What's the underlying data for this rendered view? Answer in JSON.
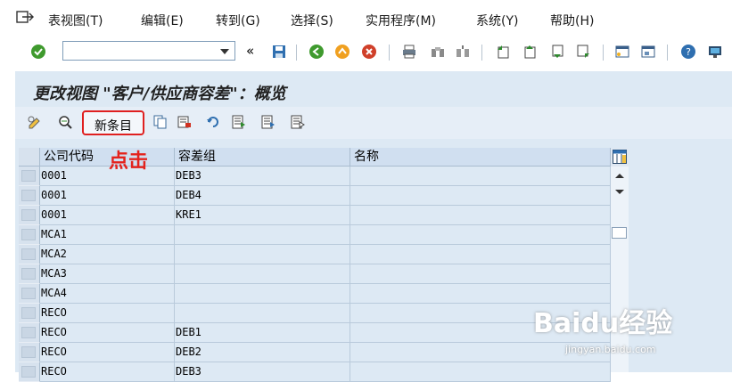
{
  "menu": [
    "表视图(T)",
    "编辑(E)",
    "转到(G)",
    "选择(S)",
    "实用程序(M)",
    "系统(Y)",
    "帮助(H)"
  ],
  "command_field": {
    "value": ""
  },
  "screen_title": "更改视图 \"客户/供应商容差\"：概览",
  "new_entries_label": "新条目",
  "annotation": "点击",
  "columns": [
    "公司代码",
    "容差组",
    "名称"
  ],
  "rows": [
    {
      "company": "0001",
      "group": "DEB3",
      "name": ""
    },
    {
      "company": "0001",
      "group": "DEB4",
      "name": ""
    },
    {
      "company": "0001",
      "group": "KRE1",
      "name": ""
    },
    {
      "company": "MCA1",
      "group": "",
      "name": ""
    },
    {
      "company": "MCA2",
      "group": "",
      "name": ""
    },
    {
      "company": "MCA3",
      "group": "",
      "name": ""
    },
    {
      "company": "MCA4",
      "group": "",
      "name": ""
    },
    {
      "company": "RECO",
      "group": "",
      "name": ""
    },
    {
      "company": "RECO",
      "group": "DEB1",
      "name": ""
    },
    {
      "company": "RECO",
      "group": "DEB2",
      "name": ""
    },
    {
      "company": "RECO",
      "group": "DEB3",
      "name": ""
    }
  ],
  "watermark": {
    "brand": "Baidu经验",
    "url": "jingyan.baidu.com"
  },
  "colors": {
    "highlight": "#e02020",
    "content_bg": "#dde9f4"
  }
}
